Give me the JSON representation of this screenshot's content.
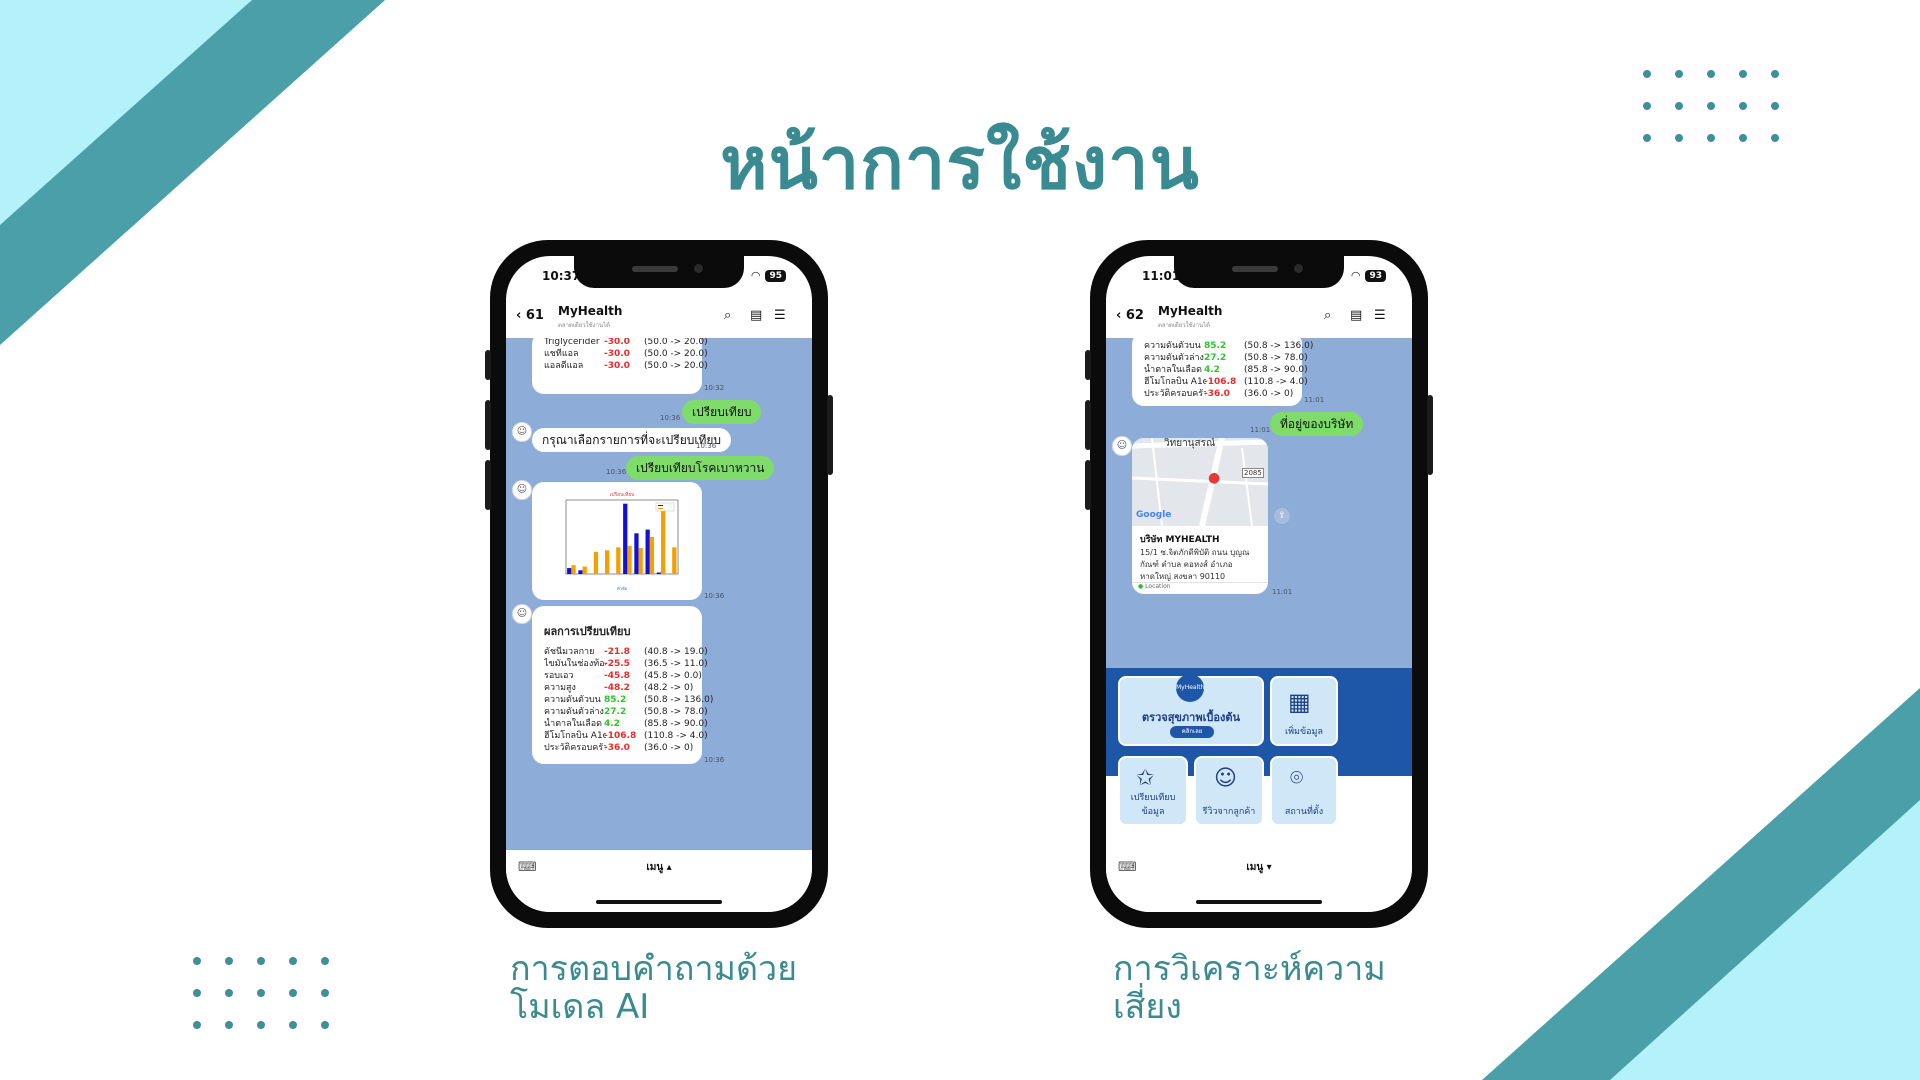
{
  "slide": {
    "title": "หน้าการใช้งาน",
    "caption_left_line1": "การตอบคำถามด้วย",
    "caption_left_line2": "โมเดล AI",
    "caption_right_line1": "การวิเคราะห์ความ",
    "caption_right_line2": "เสี่ยง",
    "colors": {
      "teal_dark": "#4a9fa8",
      "teal_light": "#b3f2fb",
      "title": "#3a8a92"
    }
  },
  "phone_left": {
    "status": {
      "time": "10:37",
      "battery": "95"
    },
    "header": {
      "back": "61",
      "name": "MyHealth",
      "sub": "ตลาดเดียวใช้งานได้"
    },
    "top_card_rows": [
      {
        "k": "Triglycerider",
        "v": "-30.0",
        "r": "(50.0 -> 20.0)"
      },
      {
        "k": "แชทีแอล",
        "v": "-30.0",
        "r": "(50.0 -> 20.0)"
      },
      {
        "k": "แอลดีแอล",
        "v": "-30.0",
        "r": "(50.0 -> 20.0)"
      }
    ],
    "ts1": "10:32",
    "msg_compare": "เปรียบเทียบ",
    "ts2": "10:36",
    "msg_bot": "กรุณาเลือกรายการที่จะเปรียบเทียบ",
    "ts3": "10:36",
    "msg_diabetes": "เปรียบเทียบโรคเบาหวาน",
    "ts4": "10:36",
    "ts5": "10:36",
    "result_title": "ผลการเปรียบเทียบ",
    "result_rows": [
      {
        "k": "ดัชนีมวลกาย",
        "v": "-21.8",
        "r": "(40.8 -> 19.0)",
        "c": "red"
      },
      {
        "k": "ไขมันในช่องท้อง",
        "v": "-25.5",
        "r": "(36.5 -> 11.0)",
        "c": "red"
      },
      {
        "k": "รอบเอว",
        "v": "-45.8",
        "r": "(45.8 -> 0.0)",
        "c": "red"
      },
      {
        "k": "ความสูง",
        "v": "-48.2",
        "r": "(48.2 -> 0)",
        "c": "red"
      },
      {
        "k": "ความดันตัวบน",
        "v": "85.2",
        "r": "(50.8 -> 136.0)",
        "c": "green"
      },
      {
        "k": "ความดันตัวล่าง",
        "v": "27.2",
        "r": "(50.8 -> 78.0)",
        "c": "green"
      },
      {
        "k": "น้ำตาลในเลือด",
        "v": "4.2",
        "r": "(85.8 -> 90.0)",
        "c": "green"
      },
      {
        "k": "ฮีโมโกลบิน A1c",
        "v": "-106.8",
        "r": "(110.8 -> 4.0)",
        "c": "red"
      },
      {
        "k": "ประวัติครอบครัว",
        "v": "-36.0",
        "r": "(36.0 -> 0)",
        "c": "red"
      }
    ],
    "ts6": "10:36",
    "menu": "เมนู ▴"
  },
  "chart_data": {
    "type": "bar",
    "title": "เปรียบเทียบ",
    "xlabel": "หัวข้อ",
    "series": [
      {
        "name": "",
        "color": "#1010d8",
        "values": [
          8,
          5,
          0,
          0,
          0,
          95,
          55,
          60,
          2,
          0
        ]
      },
      {
        "name": "",
        "color": "#f5a000",
        "values": [
          12,
          10,
          30,
          32,
          36,
          38,
          35,
          50,
          85,
          36
        ]
      }
    ],
    "ylim": [
      0,
      100
    ]
  },
  "phone_right": {
    "status": {
      "time": "11:01",
      "battery": "93"
    },
    "header": {
      "back": "62",
      "name": "MyHealth",
      "sub": "ตลาดเดียวใช้งานได้"
    },
    "top_rows": [
      {
        "k": "ความดันตัวบน",
        "v": "85.2",
        "r": "(50.8 -> 136.0)",
        "c": "green"
      },
      {
        "k": "ความดันตัวล่าง",
        "v": "27.2",
        "r": "(50.8 -> 78.0)",
        "c": "green"
      },
      {
        "k": "น้ำตาลในเลือด",
        "v": "4.2",
        "r": "(85.8 -> 90.0)",
        "c": "green"
      },
      {
        "k": "ฮีโมโกลบิน A1c",
        "v": "-106.8",
        "r": "(110.8 -> 4.0)",
        "c": "red"
      },
      {
        "k": "ประวัติครอบครัว",
        "v": "-36.0",
        "r": "(36.0 -> 0)",
        "c": "red"
      }
    ],
    "ts1": "11:01",
    "msg_location": "ที่อยู่ของบริษัท",
    "ts2": "11:01",
    "map": {
      "road_label": "วิทยานุสรณ์",
      "road_num": "2085",
      "google": "Google"
    },
    "loc_name": "บริษัท MYHEALTH",
    "loc_addr1": "15/1 ซ.จิตภักดีพิบัติ ถนน บุญณ",
    "loc_addr2": "กัณฑ์ ตำบล คอหงส์ อำเภอ",
    "loc_addr3": "หาดใหญ่ สงขลา 90110",
    "loc_tag": "Location",
    "ts3": "11:01",
    "rich": {
      "logo": "MyHealth",
      "main": "ตรวจสุขภาพเบื้องต้น",
      "main_btn": "คลิกเลย",
      "add": "เพิ่มข้อมูล",
      "compare": "เปรียบเทียบข้อมูล",
      "review": "รีวิวจากลูกค้า",
      "location": "สถานที่ตั้ง"
    },
    "menu": "เมนู ▾"
  }
}
